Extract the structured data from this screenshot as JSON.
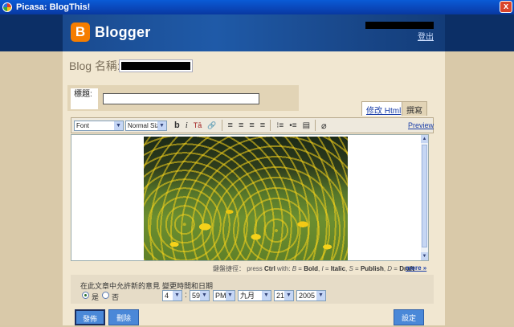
{
  "window": {
    "title": "Picasa: BlogThis!",
    "close_label": "x"
  },
  "header": {
    "brand": "Blogger",
    "logo_letter": "B",
    "logout": "登出"
  },
  "blog": {
    "name_label": "Blog 名稱:"
  },
  "post": {
    "title_label": "標題:"
  },
  "tabs": {
    "edit_html": "修改 Html",
    "compose": "撰寫"
  },
  "toolbar": {
    "font_select": "Font",
    "size_select": "Normal Size",
    "bold": "b",
    "italic": "i",
    "text_color": "Tā",
    "link": "🔗",
    "align_left": "≡",
    "align_center": "≡",
    "align_right": "≡",
    "align_justify": "≡",
    "numbered_list": "⁝≡",
    "bullet_list": "•≡",
    "blockquote": "▤",
    "remove_format": "⌀",
    "preview": "Preview"
  },
  "shortcuts": {
    "label": "鍵盤捷徑：",
    "text_prefix": "press",
    "ctrl": "Ctrl",
    "with": "with:",
    "b_key": "B",
    "b_action": "Bold",
    "i_key": "I",
    "i_action": "Italic",
    "s_key": "S",
    "s_action": "Publish",
    "d_key": "D",
    "d_action": "Draft",
    "more": "more »"
  },
  "comments": {
    "label": "在此文章中允許新的意見",
    "yes": "是",
    "no": "否",
    "selected": "yes"
  },
  "datetime": {
    "label": "變更時間和日期",
    "hour": "4",
    "minute": "59",
    "ampm": "PM",
    "month": "九月",
    "day": "21",
    "year": "2005"
  },
  "buttons": {
    "publish": "發佈",
    "delete": "刪除",
    "settings": "設定"
  }
}
